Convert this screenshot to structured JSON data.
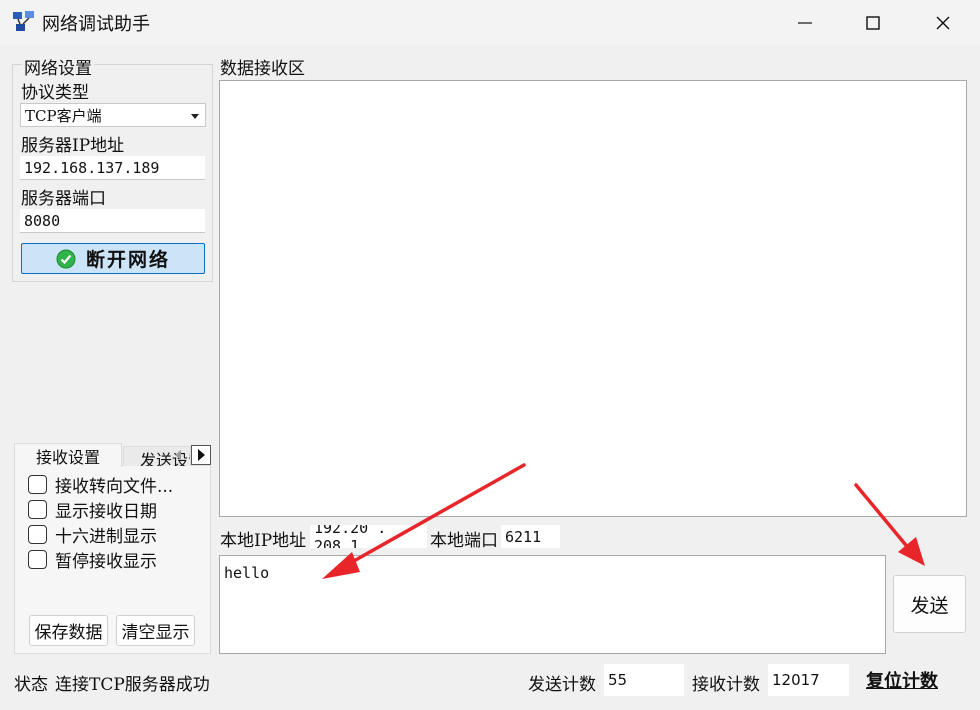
{
  "window": {
    "title": "网络调试助手"
  },
  "network_settings": {
    "legend": "网络设置",
    "protocol_label": "协议类型",
    "protocol_value": "TCP客户端",
    "server_ip_label": "服务器IP地址",
    "server_ip_value": "192.168.137.189",
    "server_port_label": "服务器端口",
    "server_port_value": "8080",
    "connect_button": "断开网络"
  },
  "receive_area": {
    "label": "数据接收区",
    "content": ""
  },
  "tabs": {
    "active": "接收设置",
    "inactive": "发送设置"
  },
  "receive_options": [
    {
      "label": "接收转向文件...",
      "checked": false
    },
    {
      "label": "显示接收日期",
      "checked": false
    },
    {
      "label": "十六进制显示",
      "checked": false
    },
    {
      "label": "暂停接收显示",
      "checked": false
    }
  ],
  "buttons": {
    "save": "保存数据",
    "clear": "清空显示",
    "send": "发送",
    "reset": "复位计数"
  },
  "local": {
    "ip_label": "本地IP地址",
    "ip_value": "192.20 . 208.1",
    "port_label": "本地端口",
    "port_value": "6211"
  },
  "send_area": {
    "content": "hello"
  },
  "status": {
    "label": "状态",
    "text": "连接TCP服务器成功",
    "send_count_label": "发送计数",
    "send_count": "55",
    "recv_count_label": "接收计数",
    "recv_count": "12017"
  },
  "colors": {
    "annotation_arrow": "#e8262a",
    "connect_button_bg": "#cce4f7",
    "check_icon": "#2fb34a"
  }
}
